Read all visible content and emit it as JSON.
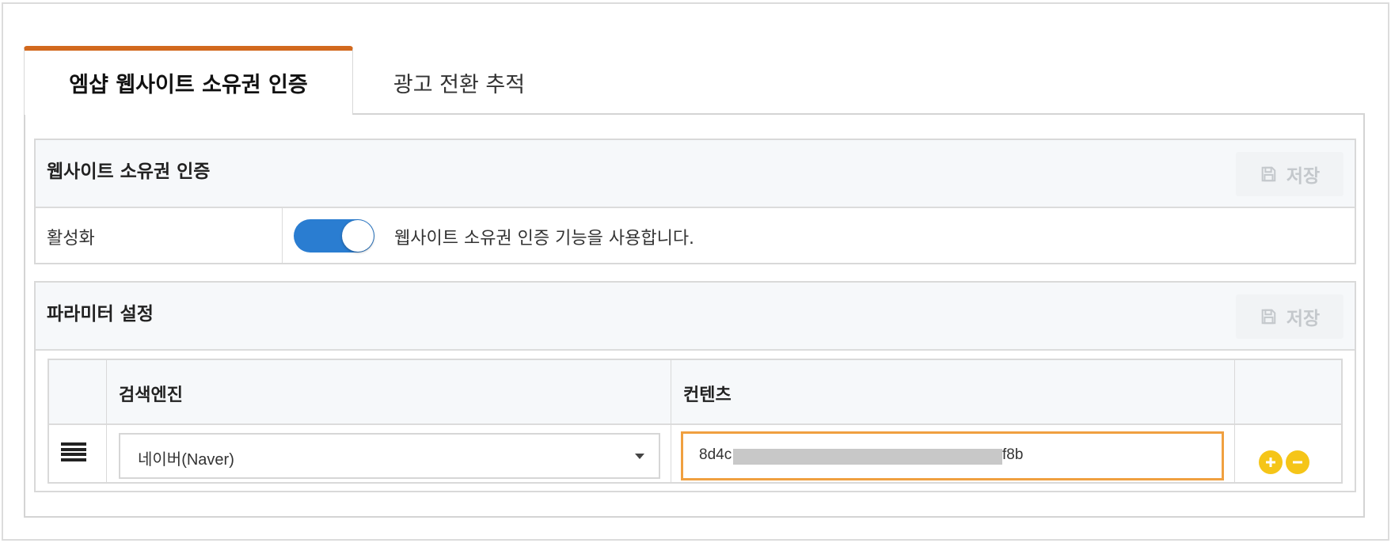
{
  "tabs": [
    {
      "label": "엠샵 웹사이트 소유권 인증",
      "active": true
    },
    {
      "label": "광고 전환 추적",
      "active": false
    }
  ],
  "accent_color": "#d2691e",
  "ownership_panel": {
    "title": "웹사이트 소유권 인증",
    "save_label": "저장",
    "save_icon": "floppy-disk-icon",
    "activate_label": "활성화",
    "toggle_on": true,
    "toggle_color": "#2a7dd1",
    "toggle_description": "웹사이트 소유권 인증 기능을 사용합니다."
  },
  "params_panel": {
    "title": "파라미터 설정",
    "save_label": "저장",
    "save_icon": "floppy-disk-icon",
    "table": {
      "headers": [
        "검색엔진",
        "컨텐츠"
      ],
      "rows": [
        {
          "drag_icon": "drag-handle-icon",
          "search_engine": "네이버(Naver)",
          "content_prefix": "8d4c",
          "content_suffix": "f8b",
          "content_redacted": true
        }
      ]
    },
    "add_icon": "plus-circle-icon",
    "remove_icon": "minus-circle-icon",
    "action_color": "#f5c518"
  }
}
